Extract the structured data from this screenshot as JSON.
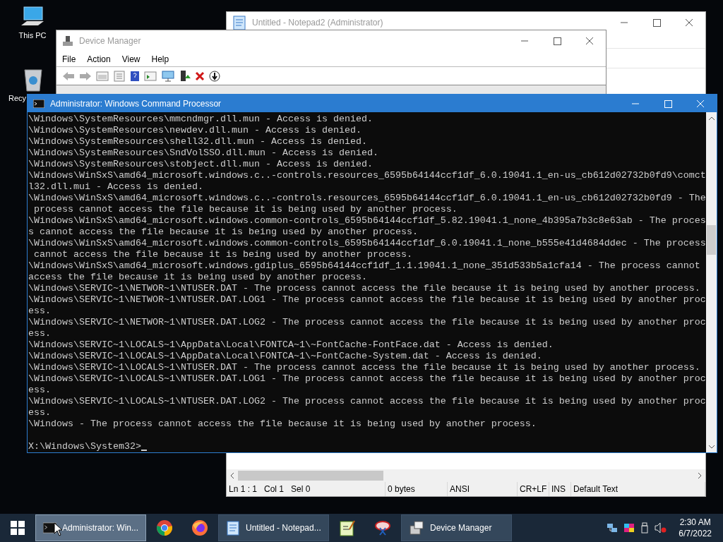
{
  "desktop_icons": [
    {
      "label": "This PC",
      "kind": "computer"
    },
    {
      "label": "Recy",
      "kind": "recycle"
    }
  ],
  "notepad": {
    "title": "Untitled - Notepad2 (Administrator)",
    "status_bar": [
      "Ln 1 : 1   Col 1   Sel 0",
      "0 bytes",
      "ANSI",
      "CR+LF",
      "INS",
      "Default Text"
    ]
  },
  "device_manager": {
    "title": "Device Manager",
    "menu": [
      "File",
      "Action",
      "View",
      "Help"
    ]
  },
  "cmd": {
    "title": "Administrator: Windows Command Processor",
    "lines": [
      "\\Windows\\SystemResources\\mmcndmgr.dll.mun - Access is denied.",
      "\\Windows\\SystemResources\\newdev.dll.mun - Access is denied.",
      "\\Windows\\SystemResources\\shell32.dll.mun - Access is denied.",
      "\\Windows\\SystemResources\\SndVolSSO.dll.mun - Access is denied.",
      "\\Windows\\SystemResources\\stobject.dll.mun - Access is denied.",
      "\\Windows\\WinSxS\\amd64_microsoft.windows.c..-controls.resources_6595b64144ccf1df_6.0.19041.1_en-us_cb612d02732b0fd9\\comct",
      "l32.dll.mui - Access is denied.",
      "\\Windows\\WinSxS\\amd64_microsoft.windows.c..-controls.resources_6595b64144ccf1df_6.0.19041.1_en-us_cb612d02732b0fd9 - The",
      " process cannot access the file because it is being used by another process.",
      "\\Windows\\WinSxS\\amd64_microsoft.windows.common-controls_6595b64144ccf1df_5.82.19041.1_none_4b395a7b3c8e63ab - The proces",
      "s cannot access the file because it is being used by another process.",
      "\\Windows\\WinSxS\\amd64_microsoft.windows.common-controls_6595b64144ccf1df_6.0.19041.1_none_b555e41d4684ddec - The process",
      " cannot access the file because it is being used by another process.",
      "\\Windows\\WinSxS\\amd64_microsoft.windows.gdiplus_6595b64144ccf1df_1.1.19041.1_none_351d533b5a1cfa14 - The process cannot",
      "access the file because it is being used by another process.",
      "\\Windows\\SERVIC~1\\NETWOR~1\\NTUSER.DAT - The process cannot access the file because it is being used by another process.",
      "\\Windows\\SERVIC~1\\NETWOR~1\\NTUSER.DAT.LOG1 - The process cannot access the file because it is being used by another proc",
      "ess.",
      "\\Windows\\SERVIC~1\\NETWOR~1\\NTUSER.DAT.LOG2 - The process cannot access the file because it is being used by another proc",
      "ess.",
      "\\Windows\\SERVIC~1\\LOCALS~1\\AppData\\Local\\FONTCA~1\\~FontCache-FontFace.dat - Access is denied.",
      "\\Windows\\SERVIC~1\\LOCALS~1\\AppData\\Local\\FONTCA~1\\~FontCache-System.dat - Access is denied.",
      "\\Windows\\SERVIC~1\\LOCALS~1\\NTUSER.DAT - The process cannot access the file because it is being used by another process.",
      "\\Windows\\SERVIC~1\\LOCALS~1\\NTUSER.DAT.LOG1 - The process cannot access the file because it is being used by another proc",
      "ess.",
      "\\Windows\\SERVIC~1\\LOCALS~1\\NTUSER.DAT.LOG2 - The process cannot access the file because it is being used by another proc",
      "ess.",
      "\\Windows - The process cannot access the file because it is being used by another process."
    ],
    "prompt": "X:\\Windows\\System32>"
  },
  "taskbar": {
    "items": [
      {
        "kind": "cmd",
        "label": "Administrator: Win...",
        "active": true
      },
      {
        "kind": "chrome"
      },
      {
        "kind": "firefox"
      },
      {
        "kind": "notepad",
        "label": "Untitled - Notepad...",
        "active": false
      },
      {
        "kind": "editor"
      },
      {
        "kind": "snip"
      },
      {
        "kind": "devmgr",
        "label": "Device Manager",
        "active": false
      }
    ],
    "clock": {
      "time": "2:30 AM",
      "date": "6/7/2022"
    }
  }
}
